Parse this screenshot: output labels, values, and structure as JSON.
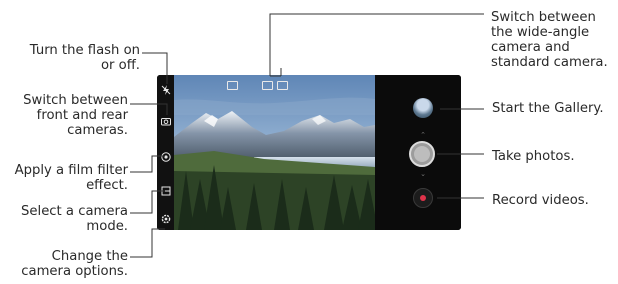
{
  "callouts": {
    "flash": "Turn the flash on\nor off.",
    "switch_cameras": "Switch between\nfront and rear\ncameras.",
    "film_filter": "Apply a film filter\neffect.",
    "camera_mode": "Select a camera\nmode.",
    "camera_options": "Change the\ncamera options.",
    "wide_angle": "Switch between\nthe wide-angle\ncamera and\nstandard camera.",
    "gallery": "Start the Gallery.",
    "take_photos": "Take photos.",
    "record_videos": "Record videos."
  },
  "icons": {
    "flash": "flash-off-icon",
    "switch_camera": "camera-switch-icon",
    "film_filter": "film-filter-icon",
    "camera_mode": "camera-mode-icon",
    "settings": "gear-icon",
    "wide_angle": "wide-angle-icon",
    "standard": "standard-lens-icon"
  },
  "colors": {
    "record_dot": "#e0334a",
    "leader_line": "#333333"
  }
}
